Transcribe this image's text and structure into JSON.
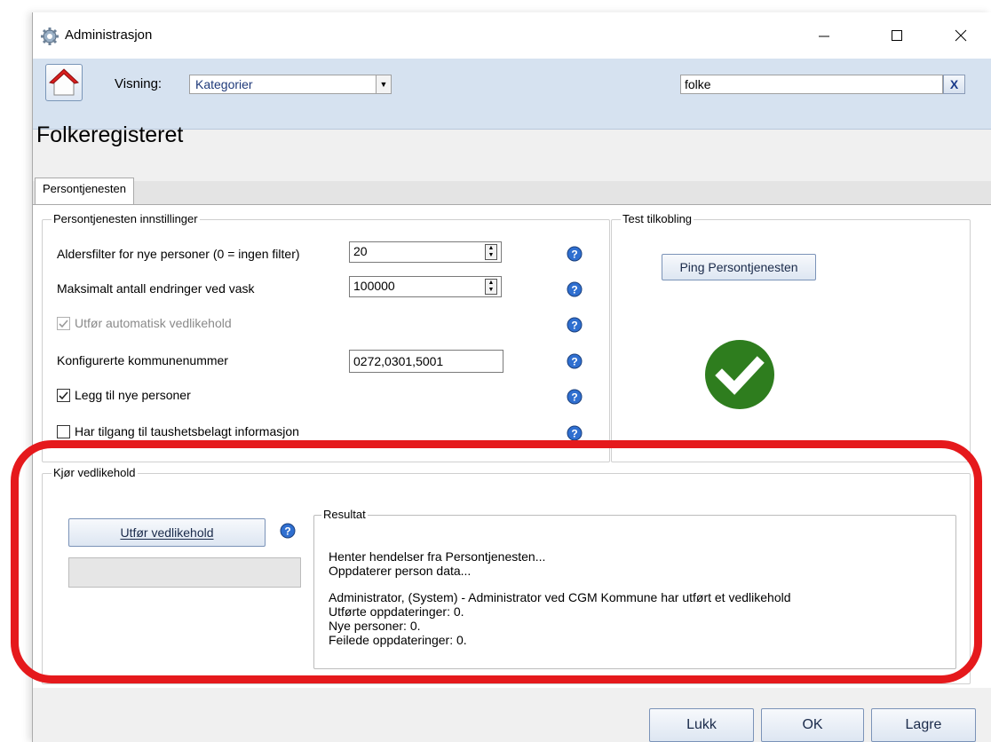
{
  "window": {
    "title": "Administrasjon"
  },
  "toolbar": {
    "visning_label": "Visning:",
    "visning_value": "Kategorier",
    "search_value": "folke",
    "search_clear": "X"
  },
  "page": {
    "title": "Folkeregisteret"
  },
  "tabs": [
    {
      "label": "Persontjenesten",
      "active": true
    }
  ],
  "settings": {
    "group_title": "Persontjenesten innstillinger",
    "age_filter_label": "Aldersfilter for nye personer (0 = ingen filter)",
    "age_filter_value": "20",
    "max_changes_label": "Maksimalt antall endringer ved vask",
    "max_changes_value": "100000",
    "auto_maintenance_label": "Utfør automatisk vedlikehold",
    "auto_maintenance_checked": true,
    "auto_maintenance_enabled": false,
    "municipality_label": "Konfigurerte kommunenummer",
    "municipality_value": "0272,0301,5001",
    "add_new_label": "Legg til nye personer",
    "add_new_checked": true,
    "confidential_label": "Har tilgang til taushetsbelagt informasjon",
    "confidential_checked": false
  },
  "test_connection": {
    "group_title": "Test tilkobling",
    "ping_button": "Ping Persontjenesten",
    "status": "success",
    "status_color": "#2e7d1e"
  },
  "maintenance": {
    "group_title": "Kjør vedlikehold",
    "run_button": "Utfør vedlikehold",
    "result_title": "Resultat",
    "result_lines": [
      "Henter hendelser fra Persontjenesten...",
      "Oppdaterer person data...",
      "",
      "Administrator, (System) - Administrator ved CGM Kommune har utført et vedlikehold",
      "Utførte oppdateringer: 0.",
      "Nye personer: 0.",
      "Feilede oppdateringer: 0."
    ]
  },
  "footer": {
    "close_button": "Lukk",
    "ok_button": "OK",
    "save_button": "Lagre"
  },
  "annotation": {
    "highlight_color": "#e5191c"
  },
  "icons": [
    "gear-icon",
    "home-icon",
    "help-icon",
    "checkmark-icon",
    "chevron-down-icon",
    "spin-up-icon",
    "spin-down-icon"
  ]
}
